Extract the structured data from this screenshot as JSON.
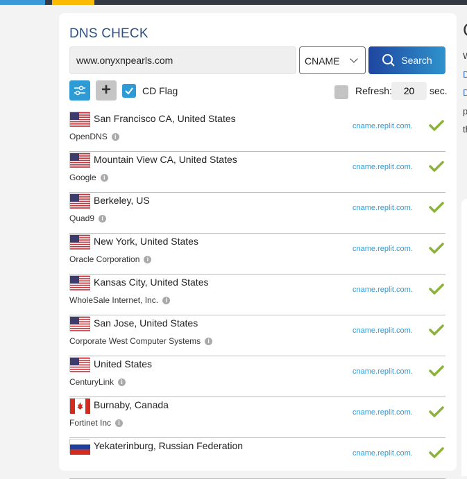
{
  "title": "DNS CHECK",
  "domain_value": "www.onyxnpearls.com",
  "record_type": "CNAME",
  "search_label": "Search",
  "cd_flag_label": "CD Flag",
  "refresh_label": "Refresh:",
  "refresh_value": "20",
  "refresh_unit": "sec.",
  "right_panel": {
    "title_partial": "C",
    "lines": [
      "W",
      "D",
      "D",
      "p",
      "th"
    ]
  },
  "results": [
    {
      "location": "San Francisco CA, United States",
      "provider": "OpenDNS",
      "flag": "us",
      "result": "cname.replit.com.",
      "status": "ok"
    },
    {
      "location": "Mountain View CA, United States",
      "provider": "Google",
      "flag": "us",
      "result": "cname.replit.com.",
      "status": "ok"
    },
    {
      "location": "Berkeley, US",
      "provider": "Quad9",
      "flag": "us",
      "result": "cname.replit.com.",
      "status": "ok"
    },
    {
      "location": "New York, United States",
      "provider": "Oracle Corporation",
      "flag": "us",
      "result": "cname.replit.com.",
      "status": "ok"
    },
    {
      "location": "Kansas City, United States",
      "provider": "WholeSale Internet, Inc.",
      "flag": "us",
      "result": "cname.replit.com.",
      "status": "ok"
    },
    {
      "location": "San Jose, United States",
      "provider": "Corporate West Computer Systems",
      "flag": "us",
      "result": "cname.replit.com.",
      "status": "ok"
    },
    {
      "location": "United States",
      "provider": "CenturyLink",
      "flag": "us",
      "result": "cname.replit.com.",
      "status": "ok"
    },
    {
      "location": "Burnaby, Canada",
      "provider": "Fortinet Inc",
      "flag": "ca",
      "result": "cname.replit.com.",
      "status": "ok"
    },
    {
      "location": "Yekaterinburg, Russian Federation",
      "provider": "",
      "flag": "ru",
      "result": "cname.replit.com.",
      "status": "ok"
    }
  ]
}
